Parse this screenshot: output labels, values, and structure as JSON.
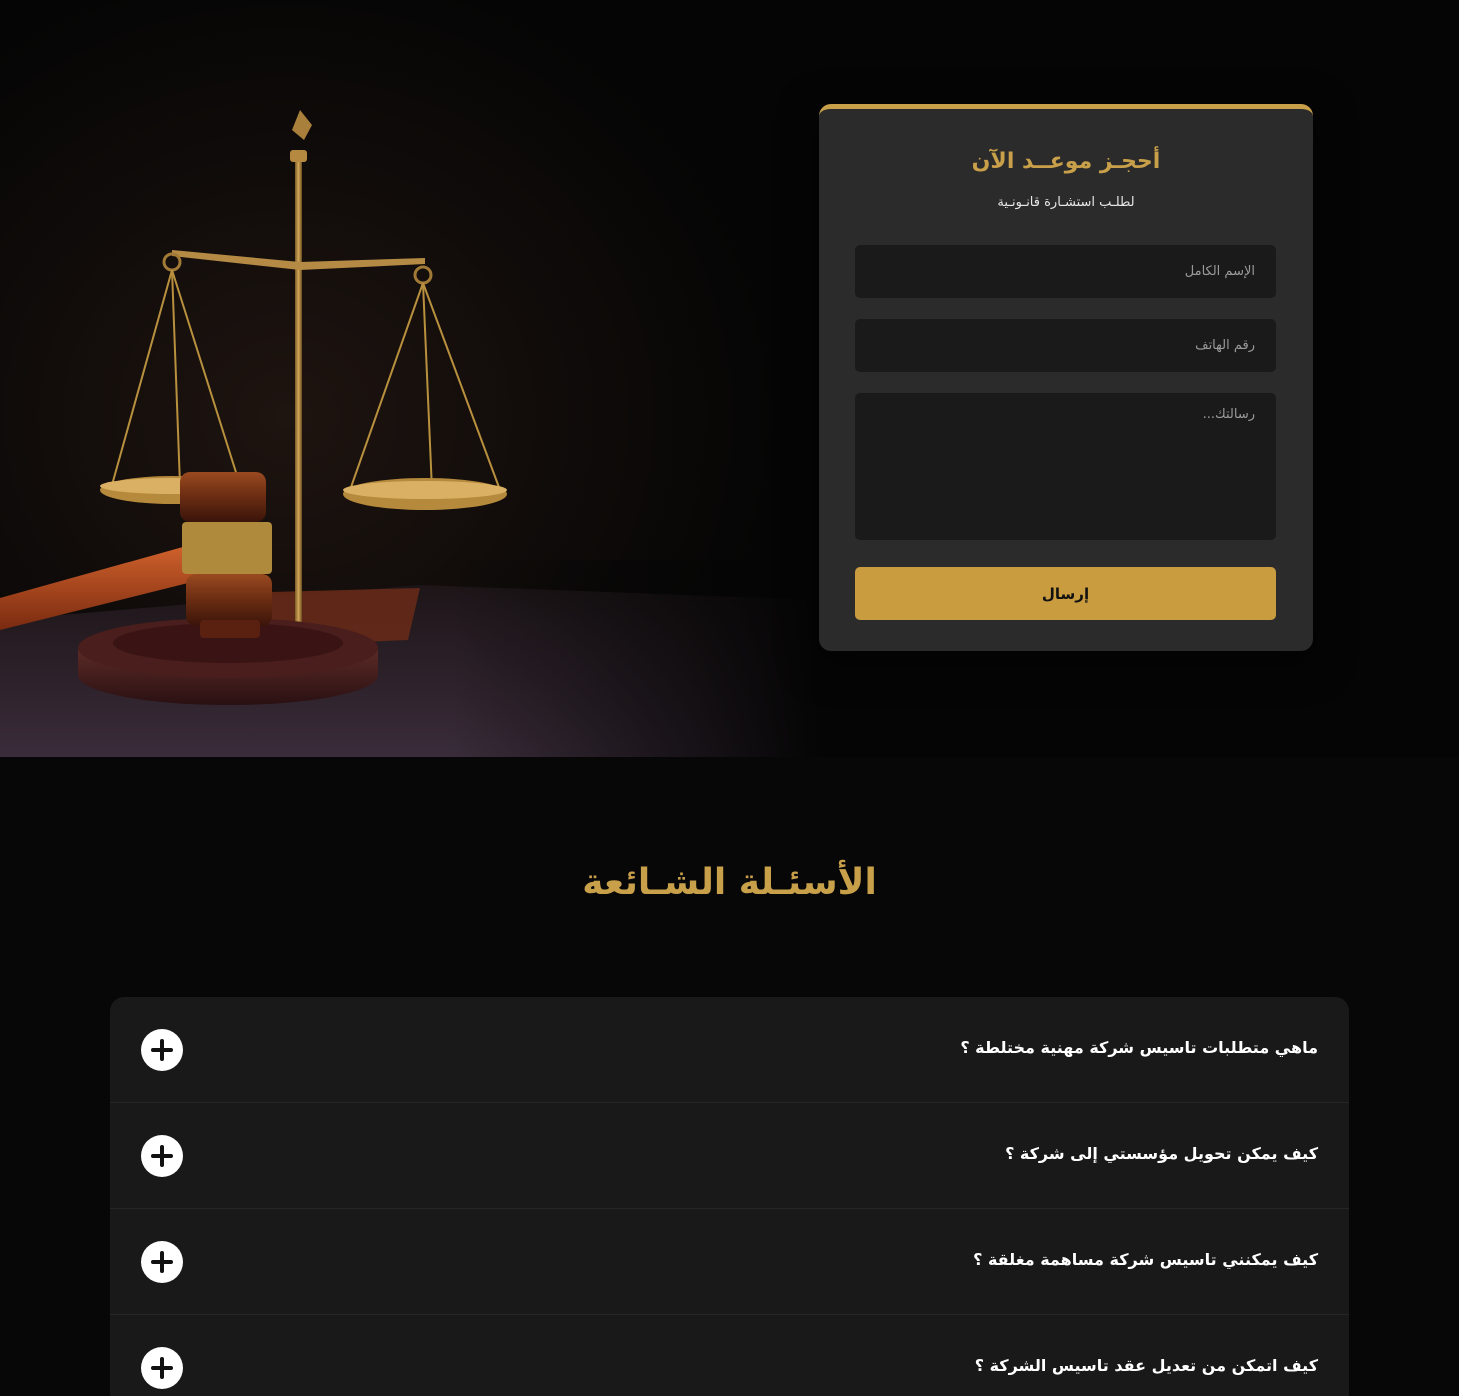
{
  "booking": {
    "title": "أحجـز موعــد الآن",
    "subtitle": "لطلـب استشـارة قانـونـية",
    "fields": {
      "name_placeholder": "الإسم الكامل",
      "phone_placeholder": "رقم الهاتف",
      "message_placeholder": "رسالتك..."
    },
    "submit_label": "إرسال"
  },
  "faq": {
    "title": "الأسئـلة الشـائعة",
    "items": [
      {
        "question": "ماهي متطلبات تاسيس شركة مهنية مختلطة ؟"
      },
      {
        "question": "كيف يمكن تحويل مؤسستي إلى شركة ؟"
      },
      {
        "question": "كيف يمكنني تاسيس شركة مساهمة مغلقة ؟"
      },
      {
        "question": "كيف اتمكن من تعديل عقد تاسيس الشركة ؟"
      }
    ]
  },
  "colors": {
    "accent": "#c9a04a",
    "button": "#c99c3f",
    "card": "#2b2b2b",
    "field": "#1a1a1a",
    "background": "#070707",
    "faq_panel": "#191919"
  },
  "icons": {
    "expand": "plus-icon",
    "hero": "scales-of-justice-and-gavel"
  }
}
